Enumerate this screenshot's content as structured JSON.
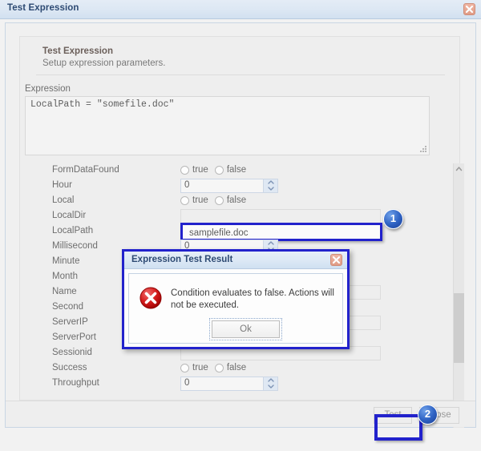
{
  "window": {
    "title": "Test Expression",
    "close_icon": "close-icon"
  },
  "header": {
    "title": "Test Expression",
    "subtitle": "Setup expression parameters."
  },
  "expression": {
    "label": "Expression",
    "value": "LocalPath = \"somefile.doc\"",
    "resize_grip": "resize-grip-icon"
  },
  "parameters": {
    "rows": [
      {
        "label": "FormDataFound",
        "type": "radio",
        "options": [
          "true",
          "false"
        ],
        "selected": ""
      },
      {
        "label": "Hour",
        "type": "spinner",
        "value": "0"
      },
      {
        "label": "Local",
        "type": "radio",
        "options": [
          "true",
          "false"
        ],
        "selected": ""
      },
      {
        "label": "LocalDir",
        "type": "text",
        "value": ""
      },
      {
        "label": "LocalPath",
        "type": "text",
        "value": "samplefile.doc",
        "highlighted": true
      },
      {
        "label": "Millisecond",
        "type": "spinner",
        "value": "0"
      },
      {
        "label": "Minute",
        "type": "spinner",
        "value": ""
      },
      {
        "label": "Month",
        "type": "spinner",
        "value": ""
      },
      {
        "label": "Name",
        "type": "text",
        "value": ""
      },
      {
        "label": "Second",
        "type": "spinner",
        "value": ""
      },
      {
        "label": "ServerIP",
        "type": "text",
        "value": ""
      },
      {
        "label": "ServerPort",
        "type": "spinner",
        "value": ""
      },
      {
        "label": "Sessionid",
        "type": "text",
        "value": ""
      },
      {
        "label": "Success",
        "type": "radio",
        "options": [
          "true",
          "false"
        ],
        "selected": ""
      },
      {
        "label": "Throughput",
        "type": "spinner",
        "value": "0"
      }
    ],
    "radio_true": "true",
    "radio_false": "false",
    "scrollbar": {
      "up_icon": "chevron-up-icon",
      "down_icon": "chevron-down-icon"
    }
  },
  "footer": {
    "test_label": "Test",
    "close_label": "Close"
  },
  "badges": [
    {
      "number": "1"
    },
    {
      "number": "2"
    }
  ],
  "modal": {
    "title": "Expression Test Result",
    "close_icon": "close-icon",
    "error_icon": "error-icon",
    "message": "Condition evaluates to false. Actions will not be executed.",
    "ok_label": "Ok"
  },
  "colors": {
    "accent": "#2222cc",
    "titlebar_text": "#2d4a73",
    "error_red": "#cc1111",
    "badge_blue": "#2f63c4"
  }
}
